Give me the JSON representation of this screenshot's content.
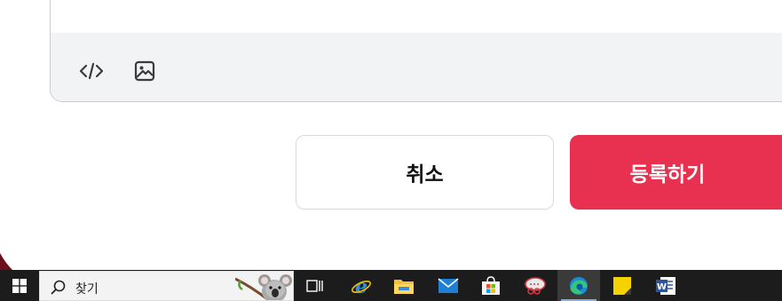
{
  "editor": {
    "toolbar": [
      {
        "name": "code-icon",
        "label": "code"
      },
      {
        "name": "image-icon",
        "label": "image"
      }
    ]
  },
  "actions": {
    "cancel_label": "취소",
    "submit_label": "등록하기"
  },
  "colors": {
    "submit_bg": "#e83150",
    "toolbar_bg": "#f2f3f5",
    "taskbar_bg": "#1c1c1c"
  },
  "taskbar": {
    "search_placeholder": "찾기",
    "apps": [
      {
        "name": "task-view-icon"
      },
      {
        "name": "internet-explorer-icon"
      },
      {
        "name": "file-explorer-icon"
      },
      {
        "name": "mail-icon"
      },
      {
        "name": "microsoft-store-icon"
      },
      {
        "name": "snipping-tool-icon"
      },
      {
        "name": "edge-icon",
        "active": true
      },
      {
        "name": "sticky-notes-icon"
      },
      {
        "name": "word-icon"
      }
    ]
  }
}
